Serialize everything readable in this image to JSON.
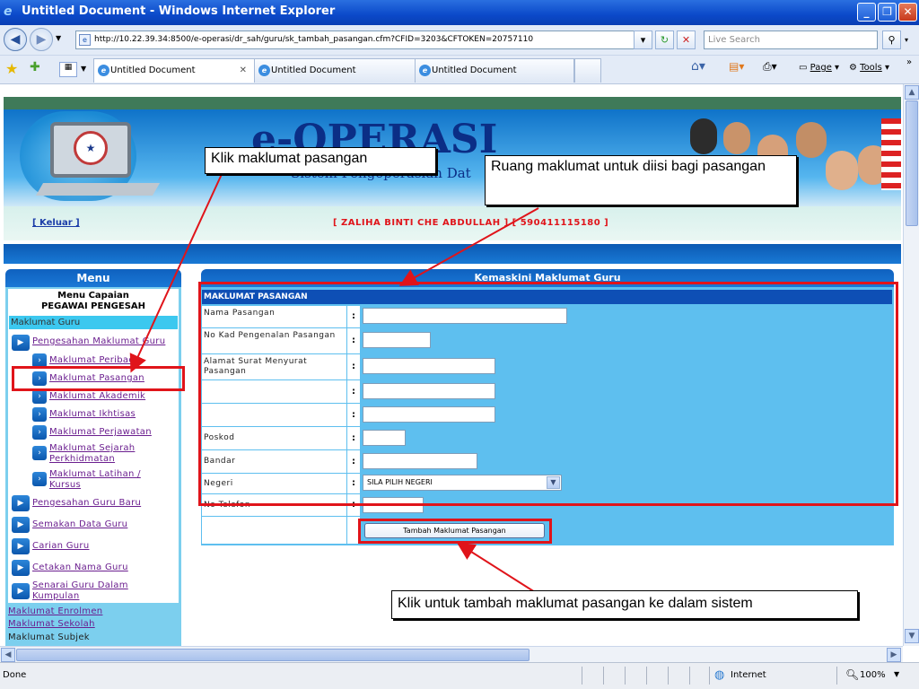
{
  "window": {
    "title": "Untitled Document - Windows Internet Explorer",
    "minimize": "_",
    "restore": "❐",
    "close": "✕"
  },
  "address": {
    "url": "http://10.22.39.34:8500/e-operasi/dr_sah/guru/sk_tambah_pasangan.cfm?CFID=3203&CFTOKEN=20757110",
    "search_placeholder": "Live Search"
  },
  "tabs": [
    "Untitled Document",
    "Untitled Document",
    "Untitled Document"
  ],
  "toolbar": {
    "page_label": "Page",
    "tools_label": "Tools"
  },
  "banner": {
    "brand": "e-OPERASI",
    "subtitle": "Sistem Pengoperasian Dat"
  },
  "userbar": {
    "logout": "[ Keluar ]",
    "user": "[ ZALIHA BINTI CHE ABDULLAH ]  [ 590411115180 ]"
  },
  "menu": {
    "title": "Menu",
    "access_title": "Menu Capaian",
    "access_role": "PEGAWAI PENGESAH",
    "section_guru": "Maklumat Guru",
    "items": [
      "Pengesahan Maklumat Guru",
      "Maklumat Peribadi",
      "Maklumat Pasangan",
      "Maklumat Akademik",
      "Maklumat Ikhtisas",
      "Maklumat Perjawatan",
      "Maklumat Sejarah Perkhidmatan",
      "Maklumat Latihan / Kursus",
      "Pengesahan Guru Baru",
      "Semakan Data Guru",
      "Carian Guru",
      "Cetakan Nama Guru",
      "Senarai Guru Dalam Kumpulan"
    ],
    "sections_bottom": [
      "Maklumat Enrolmen",
      "Maklumat Sekolah",
      "Maklumat Subjek"
    ]
  },
  "form": {
    "title": "Kemaskini Maklumat Guru",
    "section": "MAKLUMAT PASANGAN",
    "labels": {
      "nama": "Nama Pasangan",
      "ic": "No Kad Pengenalan Pasangan",
      "alamat": "Alamat Surat Menyurat Pasangan",
      "poskod": "Poskod",
      "bandar": "Bandar",
      "negeri": "Negeri",
      "telefon": "No Telefon"
    },
    "colon": ":",
    "negeri_selected": "SILA PILIH NEGERI",
    "add_button": "Tambah Maklumat Pasangan"
  },
  "annotations": {
    "a1": "Klik maklumat pasangan",
    "a2": "Ruang maklumat untuk diisi bagi pasangan",
    "a3": "Klik untuk tambah maklumat  pasangan ke dalam sistem"
  },
  "status": {
    "left": "Done",
    "zone": "Internet",
    "zoom": "100%"
  },
  "colors": {
    "accent_red": "#e0141a",
    "form_blue": "#5ebfef",
    "header_blue": "#0e4fb5"
  },
  "icons": [
    "ie-icon",
    "back-icon",
    "forward-icon",
    "refresh-icon",
    "stop-icon",
    "search-icon",
    "favorites-star-icon",
    "add-favorites-icon",
    "home-icon",
    "feeds-icon",
    "print-icon",
    "page-icon",
    "tools-icon",
    "globe-icon",
    "zoom-icon"
  ]
}
